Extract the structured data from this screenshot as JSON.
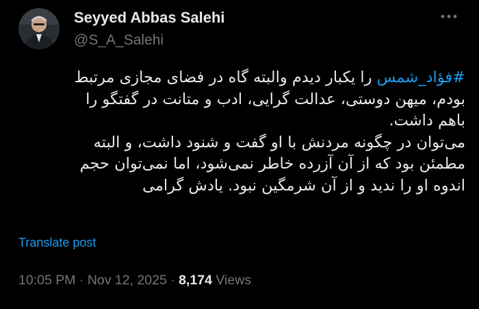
{
  "author": {
    "display_name": "Seyyed Abbas Salehi",
    "handle": "@S_A_Salehi",
    "avatar_icon": "profile-photo"
  },
  "header": {
    "more_icon": "more-horizontal-icon"
  },
  "tweet": {
    "hashtag": "#فؤاد_شمس",
    "lines": [
      " را یکبار دیدم والبته گاه در فضای مجازی مرتبط",
      "بودم، میهن دوستی، عدالت گرایی، ادب و متانت در گفتگو را",
      "باهم داشت.",
      "می‌توان در چگونه مردنش با او گفت و شنود داشت، و البته",
      "مطمئن بود که از آن آزرده خاطر نمی‌شود، اما نمی‌توان حجم",
      "اندوه او را ندید و از آن شرمگین نبود. یادش گرامی"
    ],
    "translate_label": "Translate post"
  },
  "meta": {
    "time": "10:05 PM",
    "separator": "·",
    "date": "Nov 12, 2025",
    "views_count": "8,174",
    "views_label": "Views"
  },
  "colors": {
    "background": "#000000",
    "text": "#e7e9ea",
    "muted": "#71767b",
    "link": "#1d9bf0"
  }
}
